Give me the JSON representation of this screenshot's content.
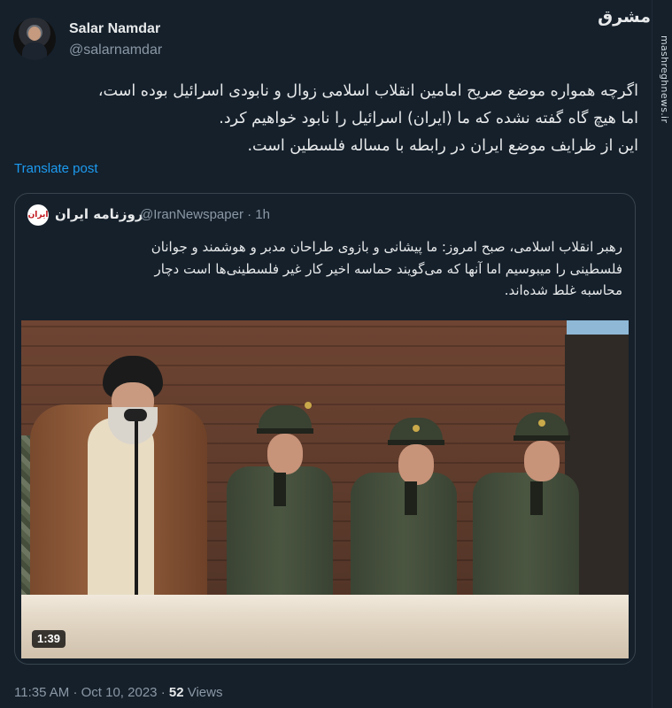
{
  "author": {
    "name": "Salar Namdar",
    "handle": "@salarnamdar"
  },
  "tweet": {
    "lines": [
      "اگرچه همواره موضع صریح امامین انقلاب اسلامی زوال و نابودی اسرائیل بوده است،",
      "اما هیچ گاه گفته نشده که ما (ایران) اسرائیل را نابود خواهیم کرد.",
      "این از ظرایف موضع ایران در رابطه با مساله فلسطین است."
    ],
    "translate_label": "Translate post"
  },
  "quoted": {
    "avatar_text": "ایران",
    "name": "روزنامه ایران",
    "handle": "@IranNewspaper",
    "time": "1h",
    "lines": [
      "رهبر انقلاب اسلامی، صبح امروز: ما پیشانی و بازوی طراحان مدبر و هوشمند و جوانان",
      "فلسطینی را میبوسیم اما آنها که می‌گویند حماسه اخیر کار غیر فلسطینی‌ها است دچار",
      "محاسبه غلط شده‌اند."
    ],
    "video_duration": "1:39"
  },
  "footer": {
    "time": "11:35 AM",
    "date": "Oct 10, 2023",
    "views_count": "52",
    "views_label": "Views"
  },
  "watermark": {
    "site": "mashreghnews.ir",
    "logo": "مشرق"
  },
  "colors": {
    "background": "#15202b",
    "text": "#e7e9ea",
    "secondary": "#8b98a5",
    "link": "#1d9bf0",
    "border": "#38444d"
  }
}
